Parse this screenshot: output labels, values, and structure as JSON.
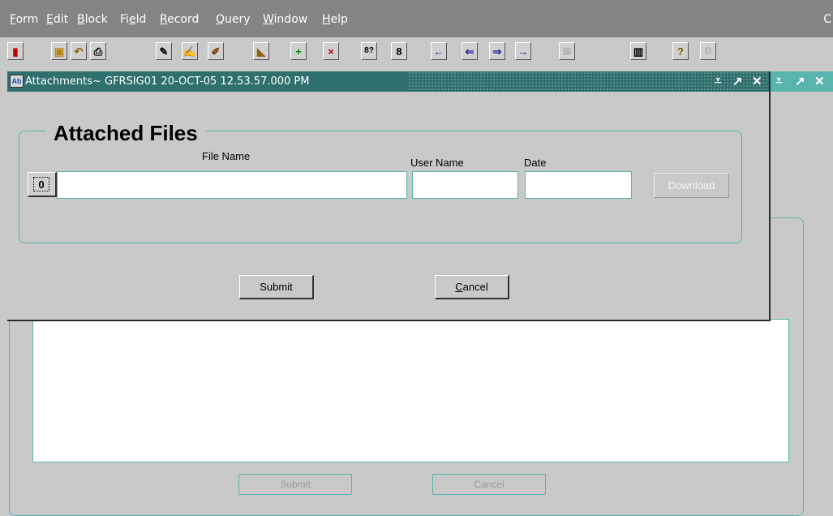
{
  "menu": [
    {
      "hot": "F",
      "rest": "orm"
    },
    {
      "hot": "E",
      "rest": "dit"
    },
    {
      "hot": "B",
      "rest": "lock"
    },
    {
      "pre": "Fi",
      "hot": "e",
      "rest": "ld"
    },
    {
      "hot": "R",
      "rest": "ecord"
    },
    {
      "hot": "Q",
      "rest": "uery"
    },
    {
      "hot": "W",
      "rest": "indow"
    },
    {
      "hot": "H",
      "rest": "elp"
    }
  ],
  "menu_corner": "C",
  "toolbar": {
    "exit_glyph": "▮",
    "save_glyph": "▣",
    "revert_glyph": "↶",
    "print_glyph": "⎙",
    "edit1_glyph": "✎",
    "edit2_glyph": "✍",
    "edit3_glyph": "✐",
    "clear_glyph": "◣",
    "insert_glyph": "+",
    "delete_glyph": "×",
    "query1_glyph": "8?",
    "query2_glyph": "8",
    "prev_block_glyph": "←",
    "prev_record_glyph": "⇐",
    "next_record_glyph": "⇒",
    "next_block_glyph": "→",
    "list_glyph": "▤",
    "clipboard_glyph": "▥",
    "help_glyph": "?",
    "d_label": "D"
  },
  "dialog": {
    "title": "Attachments~ GFRSIG01  20-OCT-05 12.53.57.000 PM",
    "icon_text": "Ab",
    "controls": {
      "minimize": "⩡",
      "maximize": "↗",
      "close": "✕"
    },
    "group_title": "Attached Files",
    "columns": {
      "file_name": "File Name",
      "user_name": "User Name",
      "date": "Date"
    },
    "paperclip_glyph": "0",
    "fields": {
      "file_name": "",
      "user_name": "",
      "date": ""
    },
    "download_label": "Download",
    "submit_label": "Submit",
    "cancel_hot": "C",
    "cancel_rest": "ancel"
  },
  "background_window": {
    "controls": {
      "minimize": "⩡",
      "maximize": "↗",
      "close": "✕"
    },
    "submit_label": "Submit",
    "cancel_label": "Cancel"
  }
}
